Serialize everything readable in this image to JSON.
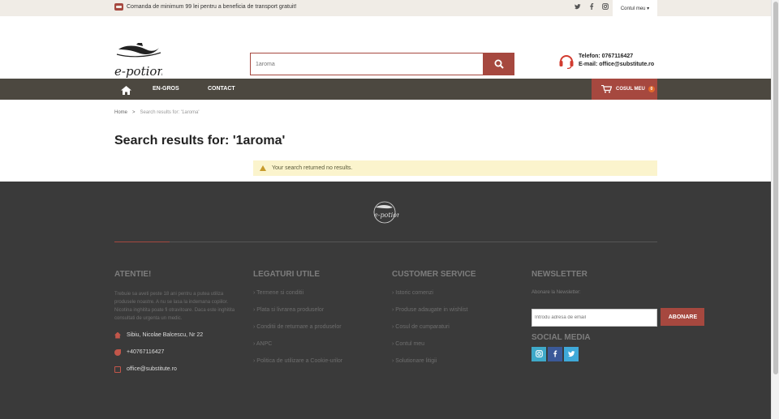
{
  "topbar": {
    "promo_text": "Comanda de minimum 99 lei pentru a beneficia de transport gratuit!",
    "account_label": "Contul meu ▾"
  },
  "header": {
    "search_value": "1aroma",
    "phone_label": "Telefon: 0767116427",
    "email_label": "E-mail: office@substitute.ro"
  },
  "nav": {
    "items": [
      {
        "label": "EN-GROS"
      },
      {
        "label": "CONTACT"
      }
    ],
    "cart_label": "COSUL MEU",
    "cart_count": "0"
  },
  "breadcrumb": {
    "home": "Home",
    "separator": ">",
    "current": "Search results for: '1aroma'"
  },
  "main": {
    "title": "Search results for: '1aroma'",
    "notice": "Your search returned no results."
  },
  "footer": {
    "col1": {
      "title": "ATENTIE!",
      "text": "Trebuie sa aveti peste 18 ani pentru a putea utiliza produsele noastre. A nu se lasa la indemana copiilor. Nicotina inghitita poate fi otravitoare. Daca este inghitita consultati de urgenta un medic.",
      "address": "Sibiu, Nicolae Balcescu, Nr 22",
      "phone": "+40767116427",
      "email": "office@substitute.ro"
    },
    "col2": {
      "title": "LEGATURI UTILE",
      "links": [
        "Termene si conditii",
        "Plata si livrarea produselor",
        "Conditii de returnare a produselor",
        "ANPC",
        "Politica de utilizare a Cookie-urilor"
      ]
    },
    "col3": {
      "title": "CUSTOMER SERVICE",
      "links": [
        "Istoric comenzi",
        "Produse adaugate in wishlist",
        "Cosul de cumparaturi",
        "Contul meu",
        "Solutionare litigii"
      ]
    },
    "col4": {
      "title": "NEWSLETTER",
      "label": "Abonare la Newsletter:",
      "placeholder": "Introdu adresa de email",
      "button": "ABONARE",
      "social_title": "SOCIAL MEDIA"
    }
  },
  "colors": {
    "accent": "#a6483f",
    "nav": "#4c4840",
    "footer": "#3a3a3a",
    "notice": "#fbf4cd"
  }
}
